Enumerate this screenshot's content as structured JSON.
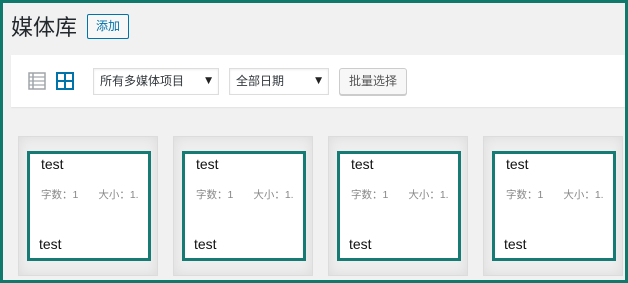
{
  "header": {
    "title": "媒体库",
    "add_label": "添加"
  },
  "toolbar": {
    "view_modes": [
      {
        "name": "list",
        "icon": "list-view-icon",
        "active": false
      },
      {
        "name": "grid",
        "icon": "grid-view-icon",
        "active": true
      }
    ],
    "type_filter": {
      "selected": "所有多媒体项目"
    },
    "date_filter": {
      "selected": "全部日期"
    },
    "bulk_select_label": "批量选择"
  },
  "attachments": [
    {
      "title": "test",
      "words": "字数：1",
      "size": "大小：1.",
      "footer": "test"
    },
    {
      "title": "test",
      "words": "字数：1",
      "size": "大小：1.",
      "footer": "test"
    },
    {
      "title": "test",
      "words": "字数：1",
      "size": "大小：1.",
      "footer": "test"
    },
    {
      "title": "test",
      "words": "字数：1",
      "size": "大小：1.",
      "footer": "test"
    }
  ],
  "colors": {
    "frame_border": "#0f7a6c",
    "card_border": "#167a75",
    "accent": "#0073aa",
    "background": "#f1f1f1"
  }
}
